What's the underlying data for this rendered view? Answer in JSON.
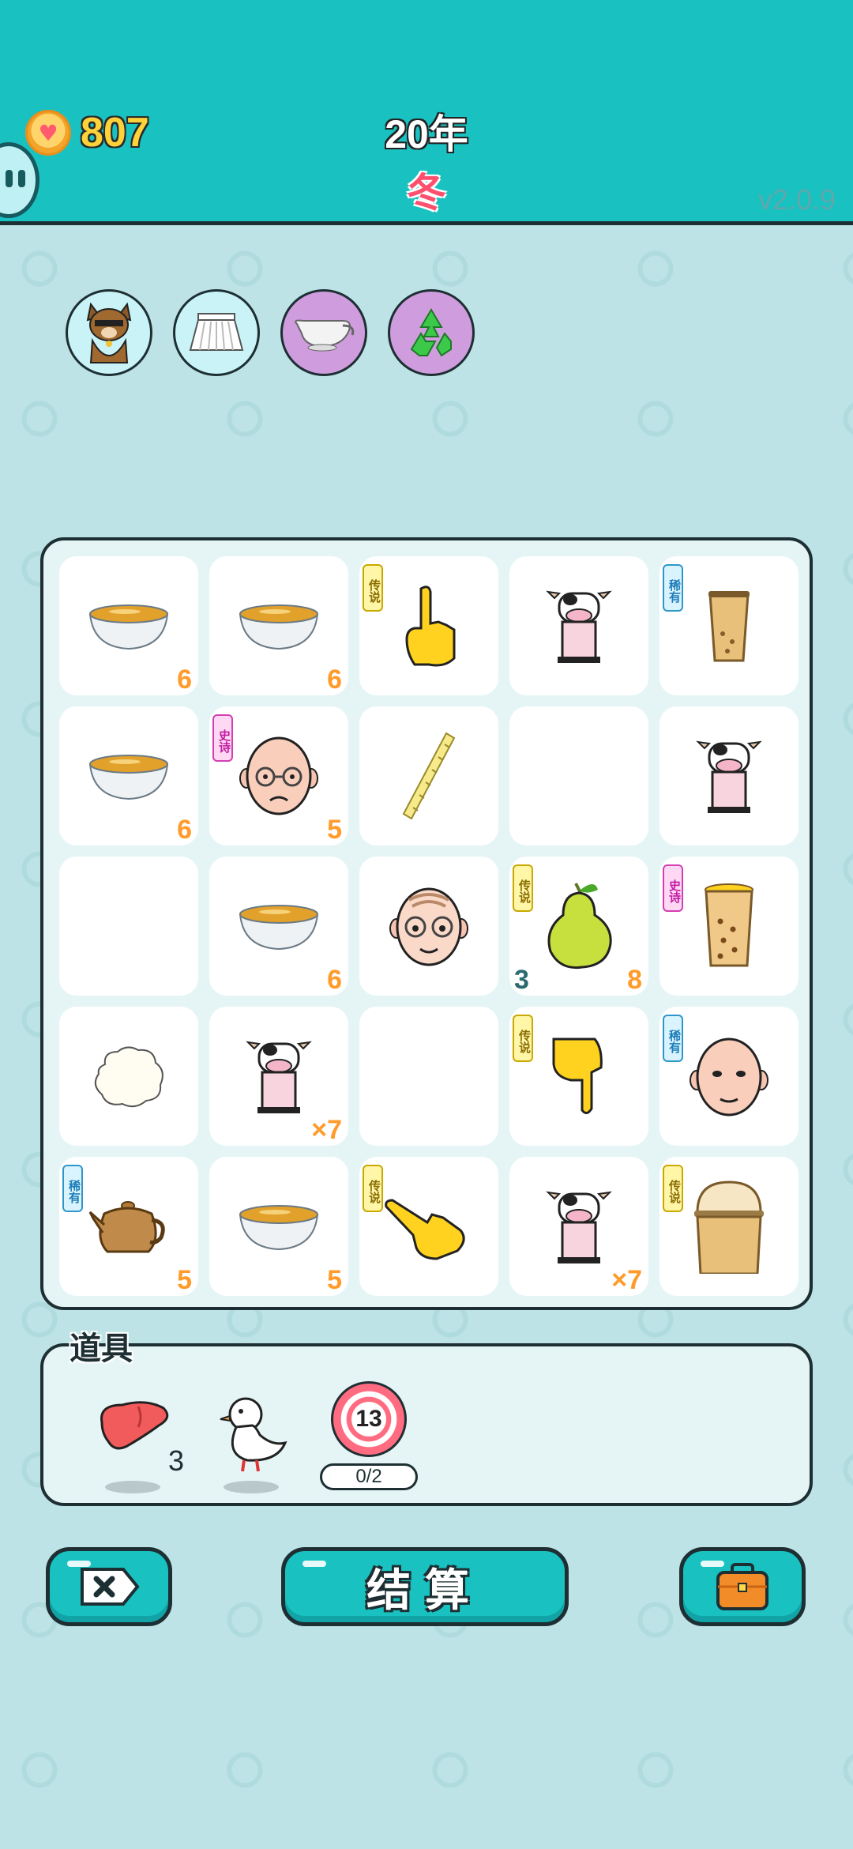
{
  "header": {
    "coins": "807",
    "year": "20年",
    "season": "冬",
    "version": "v2.0.9"
  },
  "status_icons": [
    "cat-icon",
    "skirt-icon",
    "gravy-boat-icon",
    "recycle-icon"
  ],
  "board": {
    "cells": [
      {
        "item": "bowl",
        "badge": "",
        "num": "6",
        "count": ""
      },
      {
        "item": "bowl",
        "badge": "",
        "num": "6",
        "count": ""
      },
      {
        "item": "hand-up",
        "badge": "传说",
        "num": "",
        "count": ""
      },
      {
        "item": "cow",
        "badge": "",
        "num": "",
        "count": ""
      },
      {
        "item": "cup",
        "badge": "稀有",
        "num": "",
        "count": ""
      },
      {
        "item": "bowl",
        "badge": "",
        "num": "6",
        "count": ""
      },
      {
        "item": "bald-man",
        "badge": "史诗",
        "num": "5",
        "count": ""
      },
      {
        "item": "straw",
        "badge": "",
        "num": "",
        "count": ""
      },
      {
        "item": "empty",
        "badge": "",
        "num": "",
        "count": ""
      },
      {
        "item": "cow",
        "badge": "",
        "num": "",
        "count": ""
      },
      {
        "item": "empty",
        "badge": "",
        "num": "",
        "count": ""
      },
      {
        "item": "bowl",
        "badge": "",
        "num": "6",
        "count": ""
      },
      {
        "item": "old-man",
        "badge": "",
        "num": "",
        "count": ""
      },
      {
        "item": "pear",
        "badge": "传说",
        "num": "8",
        "count": "3"
      },
      {
        "item": "bubble-tea",
        "badge": "史诗",
        "num": "",
        "count": ""
      },
      {
        "item": "cotton",
        "badge": "",
        "num": "",
        "count": ""
      },
      {
        "item": "cow",
        "badge": "",
        "num": "×7",
        "count": ""
      },
      {
        "item": "empty",
        "badge": "",
        "num": "",
        "count": ""
      },
      {
        "item": "hand-down",
        "badge": "传说",
        "num": "",
        "count": ""
      },
      {
        "item": "bald-man-2",
        "badge": "稀有",
        "num": "",
        "count": ""
      },
      {
        "item": "teapot",
        "badge": "稀有",
        "num": "5",
        "count": ""
      },
      {
        "item": "bowl",
        "badge": "",
        "num": "5",
        "count": ""
      },
      {
        "item": "hand-right",
        "badge": "传说",
        "num": "",
        "count": ""
      },
      {
        "item": "cow",
        "badge": "",
        "num": "×7",
        "count": ""
      },
      {
        "item": "dome-tea",
        "badge": "传说",
        "num": "",
        "count": ""
      }
    ]
  },
  "items_panel": {
    "label": "道具",
    "liver_count": "3",
    "target_value": "13",
    "target_progress": "0/2"
  },
  "buttons": {
    "settle": "结算"
  },
  "colors": {
    "header_bg": "#19c1c1",
    "page_bg": "#bde3e6",
    "coin_text": "#ffd23a",
    "season_text": "#ff4f6e",
    "number_text": "#ff9b2b"
  }
}
